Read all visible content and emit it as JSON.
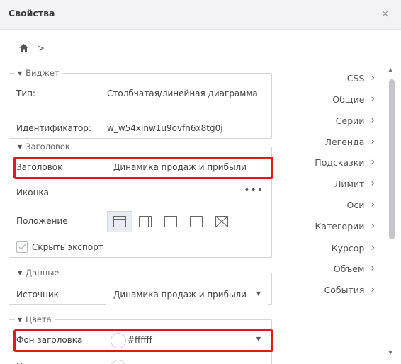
{
  "header": {
    "title": "Свойства",
    "close": "×"
  },
  "breadcrumb": {
    "sep": ">"
  },
  "widget": {
    "legend": "Виджет",
    "type_label": "Тип:",
    "type_value": "Столбчатая/линейная диаграмма",
    "id_label": "Идентификатор:",
    "id_value": "w_w54xinw1u9ovfn6x8tg0j"
  },
  "title_section": {
    "legend": "Заголовок",
    "title_label": "Заголовок",
    "title_value": "Динамика продаж и прибыли",
    "icon_label": "Иконка",
    "icon_value": "",
    "icon_more": "•••",
    "position_label": "Положение",
    "hide_export_label": "Скрыть экспорт"
  },
  "data_section": {
    "legend": "Данные",
    "source_label": "Источник",
    "source_value": "Динамика продаж и прибыли"
  },
  "colors_section": {
    "legend": "Цвета",
    "header_bg_label": "Фон заголовка",
    "header_bg_value": "#ffffff",
    "next_label": "И"
  },
  "nav": [
    "CSS",
    "Общие",
    "Серии",
    "Легенда",
    "Подсказки",
    "Лимит",
    "Оси",
    "Категории",
    "Курсор",
    "Объем",
    "События"
  ],
  "colors": {
    "highlight": "#e01919",
    "accent_bg": "#f3f3f5"
  }
}
